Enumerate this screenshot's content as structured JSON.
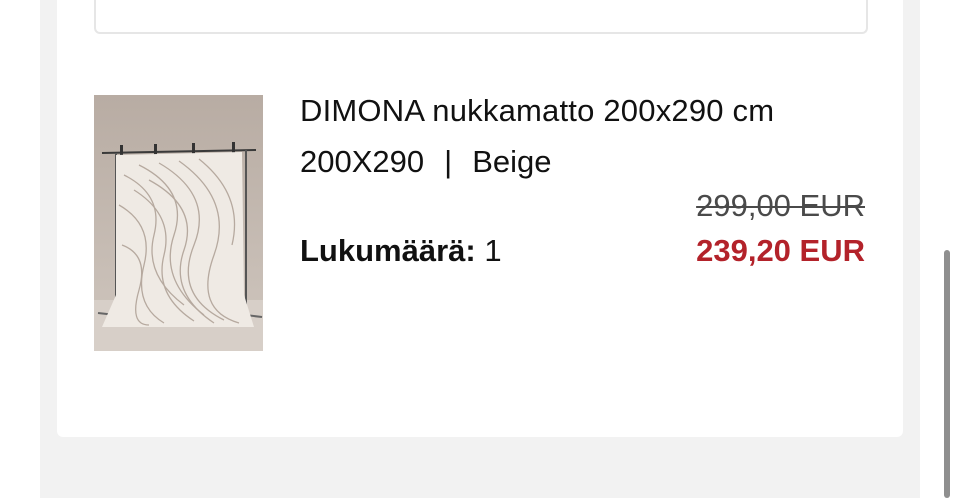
{
  "product": {
    "title": "DIMONA nukkamatto 200x290 cm",
    "size": "200X290",
    "separator": "|",
    "color": "Beige",
    "old_price": "299,00 EUR",
    "quantity_label": "Lukumäärä:",
    "quantity_value": "1",
    "price": "239,20 EUR",
    "image_icon": "rug-product-image"
  },
  "colors": {
    "price_sale": "#b3222a",
    "old_price": "#4a4a4a",
    "text": "#111111",
    "page_background": "#f2f2f2"
  }
}
